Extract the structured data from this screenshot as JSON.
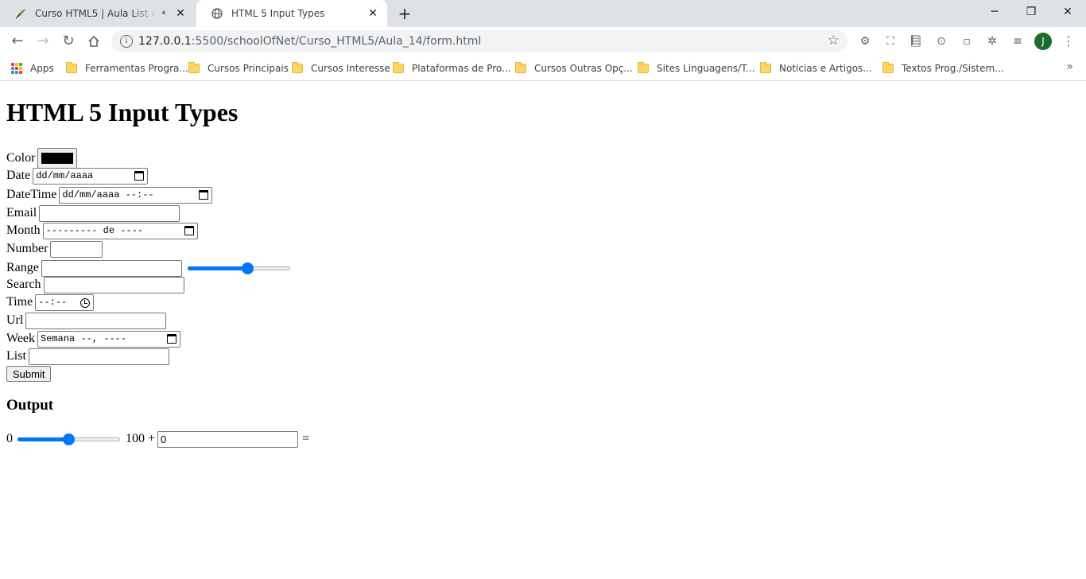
{
  "browser": {
    "tabs": [
      {
        "title": "Curso HTML5 | Aula List e tra",
        "icon": "feather-icon",
        "audio": true,
        "active": false
      },
      {
        "title": "HTML 5 Input Types",
        "icon": "globe-icon",
        "active": true
      }
    ],
    "window_controls": {
      "minimize": "─",
      "restore": "❐",
      "close": "✕"
    },
    "url_host": "127.0.0.1",
    "url_rest": ":5500/schoolOfNet/Curso_HTML5/Aula_14/form.html",
    "profile_initial": "J",
    "bookmarks": [
      {
        "label": "Apps",
        "type": "apps"
      },
      {
        "label": "Ferramentas Progra...",
        "type": "folder"
      },
      {
        "label": "Cursos Principais",
        "type": "folder"
      },
      {
        "label": "Cursos Interesse",
        "type": "folder"
      },
      {
        "label": "Plataformas de Pro...",
        "type": "folder"
      },
      {
        "label": "Cursos Outras Opç...",
        "type": "folder"
      },
      {
        "label": "Sites Linguagens/T...",
        "type": "folder"
      },
      {
        "label": "Noticias e Artigos...",
        "type": "folder"
      },
      {
        "label": "Textos Prog./Sistem...",
        "type": "folder"
      }
    ],
    "more_bookmarks": "»"
  },
  "page": {
    "heading": "HTML 5 Input Types",
    "fields": {
      "color": {
        "label": "Color",
        "value": "#000000"
      },
      "date": {
        "label": "Date",
        "placeholder": "dd/mm/aaaa"
      },
      "datetime": {
        "label": "DateTime",
        "placeholder": "dd/mm/aaaa --:--"
      },
      "email": {
        "label": "Email",
        "value": ""
      },
      "month": {
        "label": "Month",
        "placeholder": "--------- de ----"
      },
      "number": {
        "label": "Number",
        "value": ""
      },
      "range": {
        "label": "Range",
        "value": "",
        "slider_fraction": 0.6
      },
      "search": {
        "label": "Search",
        "value": ""
      },
      "time": {
        "label": "Time",
        "placeholder": "--:--"
      },
      "url": {
        "label": "Url",
        "value": ""
      },
      "week": {
        "label": "Week",
        "placeholder": "Semana --, ----"
      },
      "list": {
        "label": "List",
        "value": ""
      }
    },
    "submit_label": "Submit",
    "output": {
      "heading": "Output",
      "min": "0",
      "max_plus": "100 +",
      "slider_fraction": 0.5,
      "input_value": "0",
      "equals": "="
    }
  }
}
